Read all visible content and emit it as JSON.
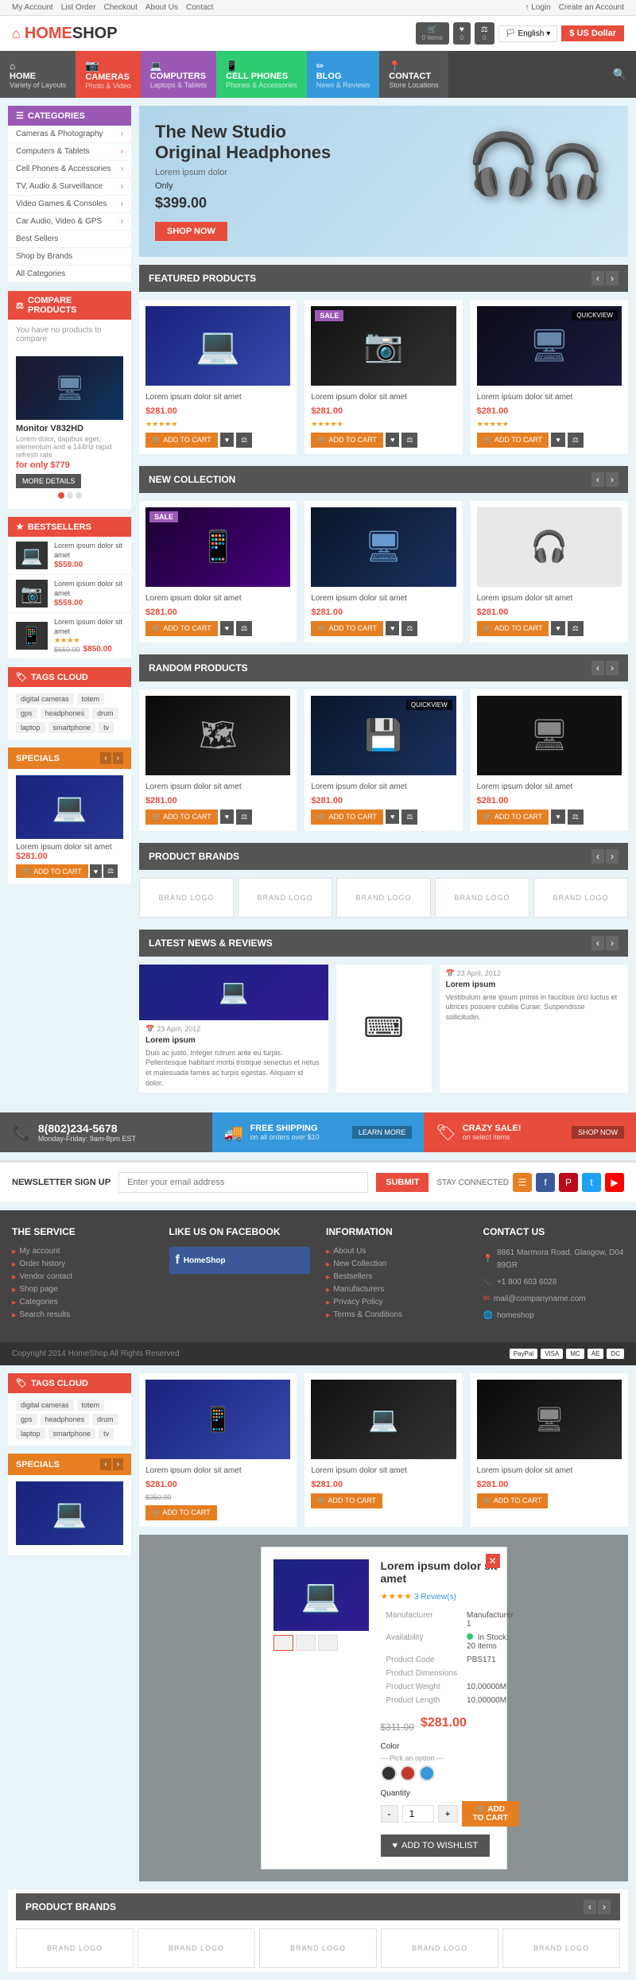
{
  "topbar": {
    "left": [
      "My Account",
      "List Order",
      "Checkout",
      "About Us",
      "Contact"
    ],
    "right_login": "↑ Login",
    "right_create": "Create an Account"
  },
  "header": {
    "logo_home": "HOME",
    "logo_shop": "SHOP",
    "cart_items": "0 Items",
    "wishlist_items": "0",
    "compare_items": "0",
    "lang": "English",
    "currency": "US Dollar"
  },
  "nav": {
    "items": [
      {
        "label": "HOME",
        "sublabel": "Variety of Layouts",
        "class": "active-home"
      },
      {
        "label": "CAMERAS",
        "sublabel": "Photo & Video",
        "class": "cameras"
      },
      {
        "label": "COMPUTERS",
        "sublabel": "Laptops & Tablets",
        "class": "computers"
      },
      {
        "label": "CELL PHONES",
        "sublabel": "Phones & Accessories",
        "class": "cell-phones"
      },
      {
        "label": "BLOG",
        "sublabel": "News & Reviews",
        "class": "blog"
      },
      {
        "label": "CONTACT",
        "sublabel": "Store Locations",
        "class": "contact"
      }
    ]
  },
  "sidebar": {
    "categories_title": "CATEGORIES",
    "categories": [
      "Cameras & Photography",
      "Computers & Tablets",
      "Cell Phones & Accessories",
      "TV, Audio & Surveillance",
      "Video Games & Consoles",
      "Car Audio, Video & GPS",
      "Best Sellers",
      "Shop by Brands",
      "All Categories"
    ],
    "compare_title": "COMPARE PRODUCTS",
    "compare_empty": "You have no products to compare",
    "compare_product": {
      "name": "Monitor V832HD",
      "desc": "Lorem dolor, dapibus eget, elementum and a 144Hz rapid refresh rate",
      "price": "$779",
      "price_prefix": "for only"
    },
    "more_details": "MORE DETAILS",
    "bestsellers_title": "BESTSELLERS",
    "bestsellers": [
      {
        "name": "Lorem ipsum dolor sit amet",
        "price": "$559.00",
        "img_type": "laptop"
      },
      {
        "name": "Lorem ipsum dolor sit amet",
        "price": "$559.00",
        "img_type": "camera"
      },
      {
        "name": "Lorem ipsum dolor sit amet",
        "price": "$850.00",
        "old_price": "$650.00",
        "stars": "★★★★",
        "img_type": "phone"
      }
    ],
    "tags_title": "TAGS CLOUD",
    "tags": [
      "digital cameras",
      "totem",
      "gps",
      "headphones",
      "drum",
      "laptop",
      "smartphone",
      "tv"
    ],
    "specials_title": "SPECIALS",
    "specials_product": {
      "name": "Lorem ipsum dolor sit amet",
      "price": "$281.00"
    }
  },
  "hero": {
    "title": "The New Studio\nOriginal Headphones",
    "subtitle": "Lorem ipsum dolor",
    "price_label": "Only",
    "price": "$399.00",
    "cta": "SHOP NOW"
  },
  "featured": {
    "title": "FEATURED PRODUCTS",
    "products": [
      {
        "name": "Lorem ipsum dolor sit amet",
        "price": "$281.00",
        "stars": "★★★★★",
        "has_sale": false,
        "img": "laptop"
      },
      {
        "name": "Lorem ipsum dolor sit amet",
        "price": "$281.00",
        "stars": "★★★★★",
        "has_sale": true,
        "img": "camera"
      },
      {
        "name": "Lorem ipsum dolor sit amet",
        "price": "$281.00",
        "stars": "★★★★★",
        "has_sale": false,
        "img": "monitor"
      }
    ],
    "add_to_cart": "ADD TO CART"
  },
  "new_collection": {
    "title": "NEW COLLECTION",
    "products": [
      {
        "name": "Lorem ipsum dolor sit amet",
        "price": "$281.00",
        "has_sale": true,
        "img": "tablet"
      },
      {
        "name": "Lorem ipsum dolor sit amet",
        "price": "$281.00",
        "has_sale": false,
        "img": "desktop"
      },
      {
        "name": "Lorem ipsum dolor sit amet",
        "price": "$281.00",
        "has_sale": false,
        "img": "headset"
      }
    ],
    "add_to_cart": "ADD TO CART"
  },
  "random": {
    "title": "RANDOM PRODUCTS",
    "products": [
      {
        "name": "Lorem ipsum dolor sit amet",
        "price": "$281.00",
        "img": "gps"
      },
      {
        "name": "Lorem ipsum dolor sit amet",
        "price": "$281.00",
        "img": "gpu"
      },
      {
        "name": "Lorem ipsum dolor sit amet",
        "price": "$281.00",
        "img": "case"
      }
    ],
    "add_to_cart": "ADD TO CART"
  },
  "brands": {
    "title": "PRODUCT BRANDS",
    "logos": [
      "BRAND LOGO",
      "BRAND LOGO",
      "BRAND LOGO",
      "BRAND LOGO",
      "BRAND LOGO"
    ]
  },
  "news": {
    "title": "LATEST NEWS & REVIEWS",
    "articles": [
      {
        "title": "Lorem ipsum",
        "date": "23 April, 2012",
        "text": "Duis ac justo. Integer rutrum ante eu turpis. Pellentesque habitant morbi tristique senectus et netus et malesuada fames ac turpis egestas. Aliquam id dolor."
      },
      {
        "title": "Lorem ipsum",
        "date": "23 April, 2012",
        "text": "Vestibulum ante ipsum primis in faucibus orci luctus et ultrices posuere cubilia Curae; Suspendisse sollicitudin."
      }
    ]
  },
  "infobar": {
    "phone": "8(802)234-5678",
    "phone_sub": "Monday-Friday: 9am-8pm EST",
    "shipping_title": "FREE SHIPPING",
    "shipping_sub": "on all orders over $10",
    "shipping_cta": "LEARN MORE",
    "sale_title": "CRAZY SALE!",
    "sale_sub": "on select items",
    "sale_cta": "SHOP NOW"
  },
  "newsletter": {
    "label": "NEWSLETTER SIGN UP",
    "placeholder": "Enter your email address",
    "submit": "SUBMIT",
    "stay_connected": "STAY CONNECTED"
  },
  "footer": {
    "service_title": "THE SERVICE",
    "service_links": [
      "My account",
      "Order history",
      "Vendor contact",
      "Shop page",
      "Categories",
      "Search results"
    ],
    "facebook_title": "LIKE US ON FACEBOOK",
    "info_title": "INFORMATION",
    "info_links": [
      "About Us",
      "New Collection",
      "Bestsellers",
      "Manufacturers",
      "Privacy Policy",
      "Terms & Conditions"
    ],
    "contact_title": "CONTACT US",
    "contact_address": "8861 Marmora Road, Glasgow, D04 89GR",
    "contact_phone": "+1 800 603 6028",
    "contact_email": "mail@companyname.com",
    "contact_web": "homeshop",
    "copyright": "Copyright 2014 HomeShop All Rights Reserved",
    "payment_methods": [
      "PayPal",
      "VISA",
      "MC",
      "AE",
      "DC"
    ]
  },
  "modal": {
    "title": "Lorem ipsum dolor sit amet",
    "stars": "★★★★",
    "reviews": "3 Review(s)",
    "manufacturer": "Manufacturer 1",
    "availability": "In Stock: 20 items",
    "product_code": "PBS171",
    "dimensions": "Product Dimensions",
    "weight": "10.00000M",
    "length": "10.00000M",
    "old_price": "$311.00",
    "price": "$281.00",
    "color_label": "Color",
    "qty_label": "Quantity",
    "qty": "1",
    "add_cart": "ADD TO CART",
    "add_wishlist": "ADD TO WISHLIST"
  },
  "icons": {
    "cart": "🛒",
    "heart": "♥",
    "compare": "⚖",
    "flag": "🏳",
    "dollar": "$",
    "search": "🔍",
    "phone": "📞",
    "truck": "🚚",
    "tag": "🏷",
    "star": "★",
    "arrow_left": "‹",
    "arrow_right": "›",
    "arrow_up": "▲",
    "arrow_right_small": "›",
    "home": "⌂",
    "calendar": "📅",
    "location": "📍",
    "phone_contact": "📞",
    "email": "✉",
    "globe": "🌐"
  }
}
